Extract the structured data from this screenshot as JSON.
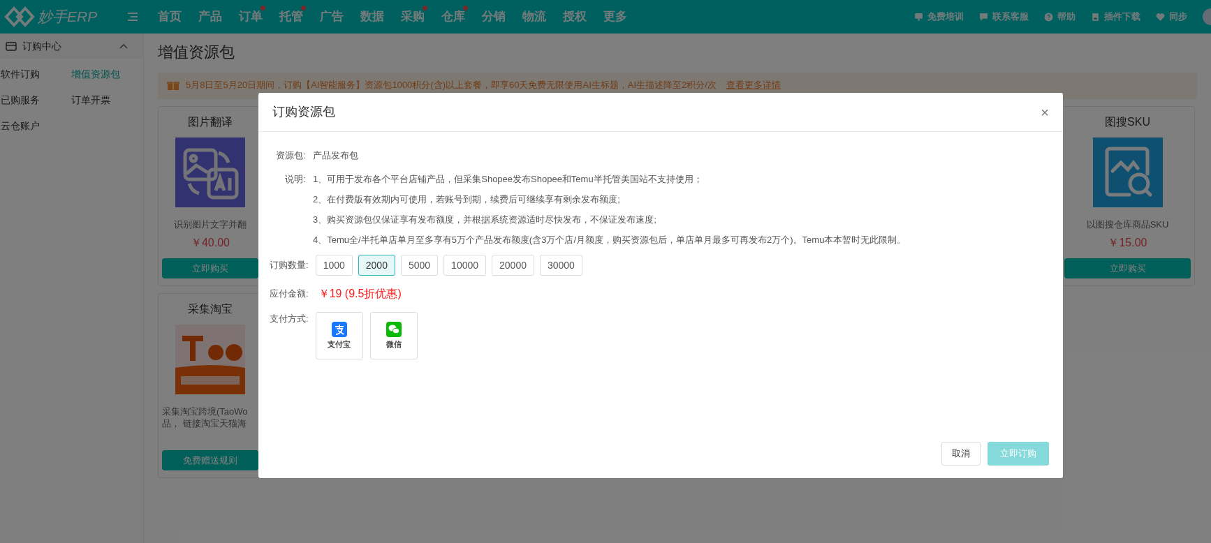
{
  "topbar": {
    "logo": "妙手ERP",
    "nav": [
      {
        "label": "首页",
        "dot": false
      },
      {
        "label": "产品",
        "dot": false
      },
      {
        "label": "订单",
        "dot": true
      },
      {
        "label": "托管",
        "dot": true
      },
      {
        "label": "广告",
        "dot": false
      },
      {
        "label": "数据",
        "dot": false
      },
      {
        "label": "采购",
        "dot": true
      },
      {
        "label": "仓库",
        "dot": true
      },
      {
        "label": "分销",
        "dot": false
      },
      {
        "label": "物流",
        "dot": false
      },
      {
        "label": "授权",
        "dot": false
      },
      {
        "label": "更多",
        "dot": false
      }
    ],
    "tools": [
      {
        "kind": "training",
        "label": "免费培训"
      },
      {
        "kind": "chat",
        "label": "联系客服"
      },
      {
        "kind": "help",
        "label": "帮助"
      },
      {
        "kind": "download",
        "label": "插件下载"
      },
      {
        "kind": "sync",
        "label": "同步"
      }
    ]
  },
  "sidebar": {
    "title": "订购中心",
    "expanded": true,
    "items": [
      {
        "label": "软件订购",
        "selected": false
      },
      {
        "label": "增值资源包",
        "selected": true
      },
      {
        "label": "已购服务",
        "selected": false
      },
      {
        "label": "订单开票",
        "selected": false
      },
      {
        "label": "云仓账户",
        "selected": false
      }
    ]
  },
  "page": {
    "title": "增值资源包",
    "banner": {
      "text": "5月8日至5月20日期间，订购【AI智能服务】资源包1000积分(含)以上套餐，即享60天免费无限使用AI生标题，AI生描述降至2积分/次",
      "link": "查看更多详情"
    },
    "cards_left": [
      {
        "kind": "translate",
        "title": "图片翻译",
        "desc": "识别图片文字并翻",
        "price": "￥40.00",
        "button": "立即购买"
      },
      {
        "kind": "taobao",
        "title": "采集淘宝",
        "desc": "采集淘宝跨境(TaoWo 品， 链接淘宝天猫海",
        "button": "免费赠送规则"
      }
    ],
    "cards_right": [
      {
        "kind": "search",
        "title": "图搜SKU",
        "desc": "以图搜仓库商品SKU",
        "price": "￥15.00",
        "button": "立即购买"
      }
    ]
  },
  "dialog": {
    "title": "订购资源包",
    "close": "×",
    "package_label": "资源包:",
    "package": "产品发布包",
    "notes_label": "说明:",
    "notes": [
      "1、可用于发布各个平台店铺产品，但采集Shopee发布Shopee和Temu半托管美国站不支持使用；",
      "2、在付费版有效期内可使用，若账号到期，续费后可继续享有剩余发布额度;",
      "3、购买资源包仅保证享有发布额度，并根据系统资源适时尽快发布，不保证发布速度;",
      "4、Temu全/半托单店单月至多享有5万个产品发布额度(含3万个店/月额度，购买资源包后，单店单月最多可再发布2万个)。Temu本本暂时无此限制。"
    ],
    "quantity_label": "订购数量:",
    "quantities": [
      {
        "label": "1000",
        "selected": false
      },
      {
        "label": "2000",
        "selected": true
      },
      {
        "label": "5000",
        "selected": false
      },
      {
        "label": "10000",
        "selected": false
      },
      {
        "label": "20000",
        "selected": false
      },
      {
        "label": "30000",
        "selected": false
      }
    ],
    "amount_label": "应付金额:",
    "amount": "￥19 (9.5折优惠)",
    "payment_label": "支付方式:",
    "payments": [
      {
        "kind": "alipay",
        "label": "支付宝"
      },
      {
        "kind": "wechat",
        "label": "微信"
      }
    ],
    "cancel": "取消",
    "submit": {
      "label": "立即订购",
      "disabled": true
    }
  }
}
